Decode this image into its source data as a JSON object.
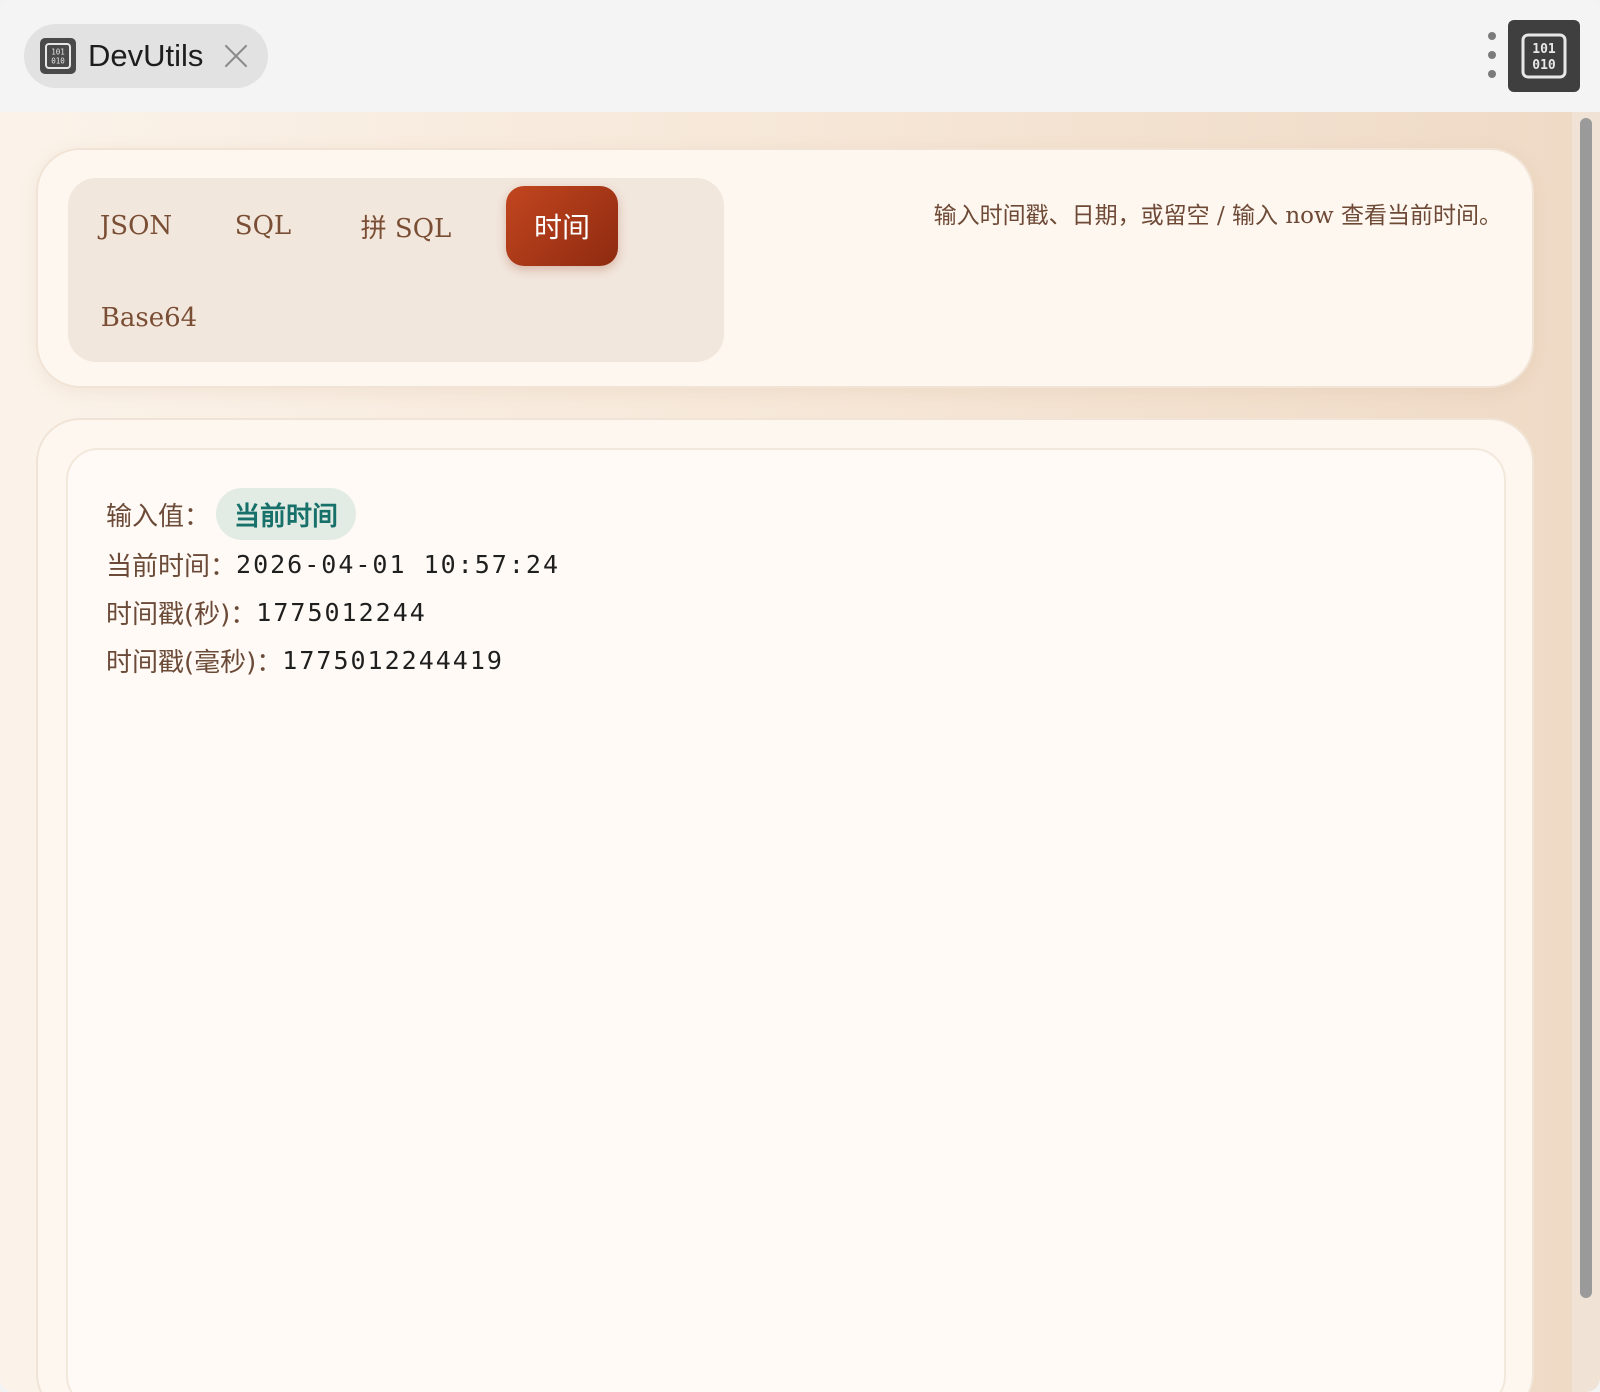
{
  "titlebar": {
    "tab_title": "DevUtils",
    "tab_icon": "binary-icon",
    "menu_icon": "kebab-menu-icon",
    "app_icon": "binary-icon"
  },
  "nav": {
    "items": [
      {
        "label": "JSON",
        "active": false
      },
      {
        "label": "SQL",
        "active": false
      },
      {
        "label": "拼 SQL",
        "active": false
      },
      {
        "label": "时间",
        "active": true
      },
      {
        "label": "Base64",
        "active": false
      }
    ],
    "active_color": "#b23a17"
  },
  "hint": "输入时间戳、日期，或留空 / 输入 now 查看当前时间。",
  "result": {
    "input_label": "输入值：",
    "input_badge": "当前时间",
    "current_time_label": "当前时间：",
    "current_time_value": "2026-04-01 10:57:24",
    "ts_sec_label": "时间戳(秒)：",
    "ts_sec_value": "1775012244",
    "ts_ms_label": "时间戳(毫秒)：",
    "ts_ms_value": "1775012244419"
  },
  "colors": {
    "badge_text": "#17716a",
    "badge_bg": "#e3ece4",
    "label_text": "#6b4a38"
  }
}
